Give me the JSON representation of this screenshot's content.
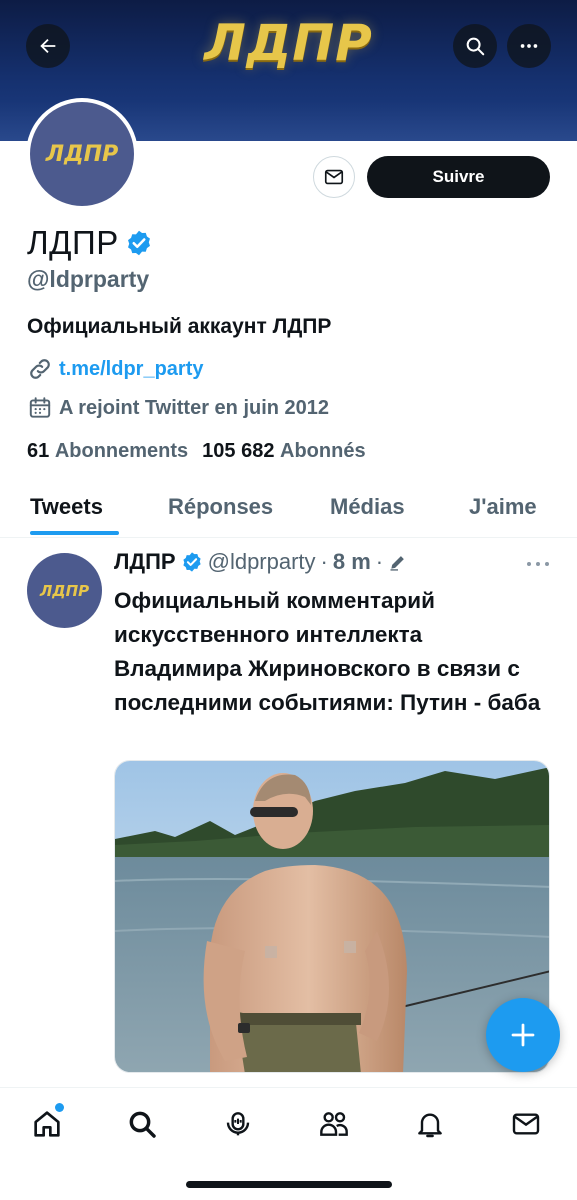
{
  "banner": {
    "logo_text": "ЛДПР"
  },
  "profile": {
    "avatar_text": "ЛДПР",
    "display_name": "ЛДПР",
    "handle": "@ldprparty",
    "bio": "Официальный аккаунт ЛДПР",
    "link": "t.me/ldpr_party",
    "joined": "A rejoint Twitter en juin 2012",
    "following_count": "61",
    "following_label": "Abonnements",
    "followers_count": "105 682",
    "followers_label": "Abonnés",
    "follow_label": "Suivre"
  },
  "tabs": [
    {
      "label": "Tweets",
      "active": true
    },
    {
      "label": "Réponses",
      "active": false
    },
    {
      "label": "Médias",
      "active": false
    },
    {
      "label": "J'aime",
      "active": false
    }
  ],
  "tweet": {
    "avatar_text": "ЛДПР",
    "name": "ЛДПР",
    "handle": "@ldprparty",
    "separator": "·",
    "time": "8 m",
    "text": "Официальный комментарий искусственного интеллекта Владимира Жириновского в связи с последними событиями: Путин - баба",
    "media": "photo"
  },
  "icons": {
    "back": "arrow-left-icon",
    "search": "search-icon",
    "more": "more-horizontal-icon",
    "message": "envelope-icon",
    "verified": "verified-badge-icon",
    "link": "link-icon",
    "calendar": "calendar-icon",
    "edit": "pencil-icon",
    "compose": "plus-icon",
    "nav": [
      "home-icon",
      "search-icon",
      "spaces-icon",
      "communities-icon",
      "bell-icon",
      "mail-icon"
    ]
  },
  "colors": {
    "accent": "#1d9bf0",
    "text": "#0f1419",
    "secondary": "#536471",
    "banner": "#15306e",
    "logo_gold": "#e7c64a"
  }
}
